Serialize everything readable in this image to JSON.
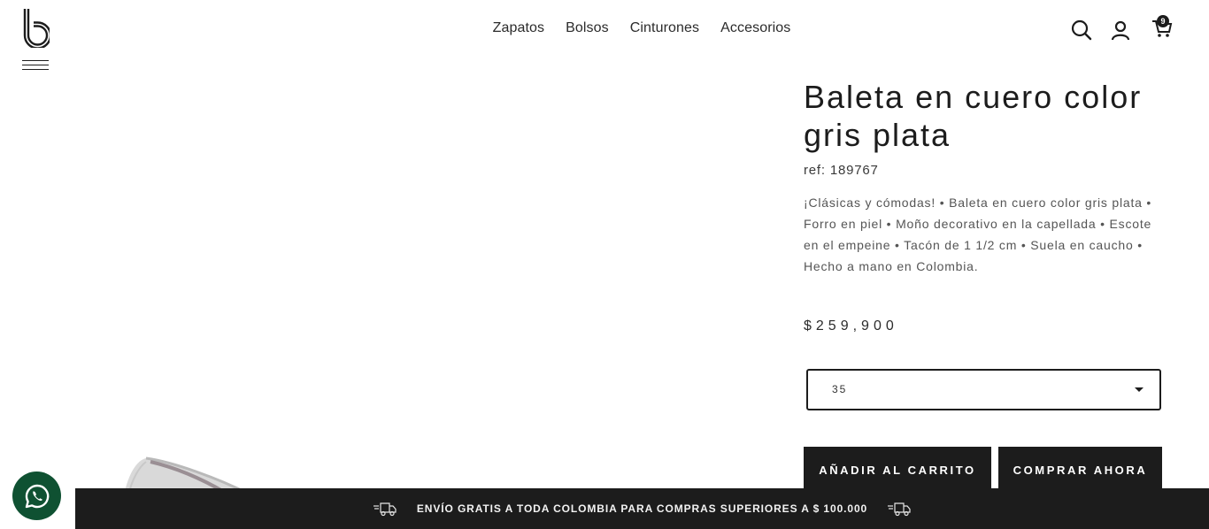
{
  "header": {
    "nav": [
      {
        "label": "Zapatos"
      },
      {
        "label": "Bolsos"
      },
      {
        "label": "Cinturones"
      },
      {
        "label": "Accesorios"
      }
    ],
    "cart_count": "9",
    "icons": {
      "logo": "b-logo-icon",
      "menu": "hamburger-menu-icon",
      "search": "search-icon",
      "user": "user-icon",
      "cart": "cart-icon"
    }
  },
  "product": {
    "title": "Baleta en cuero color gris plata",
    "ref": "ref: 189767",
    "description": "¡Clásicas y cómodas! • Baleta en cuero color gris plata • Forro en piel • Moño decorativo en la capellada • Escote en el empeine • Tacón de 1 1/2 cm • Suela en caucho • Hecho a mano en Colombia.",
    "price": "$259,900",
    "size_selected": "35"
  },
  "actions": {
    "add_to_cart": "AÑADIR AL CARRITO",
    "buy_now": "COMPRAR AHORA"
  },
  "banner": {
    "text": "ENVÍO GRATIS A TODA COLOMBIA PARA COMPRAS SUPERIORES A $ 100.000",
    "icon": "delivery-truck-icon"
  },
  "floating": {
    "whatsapp_icon": "whatsapp-icon",
    "color": "#0f5132"
  },
  "colors": {
    "primary": "#1c1c1c",
    "background": "#ffffff"
  }
}
